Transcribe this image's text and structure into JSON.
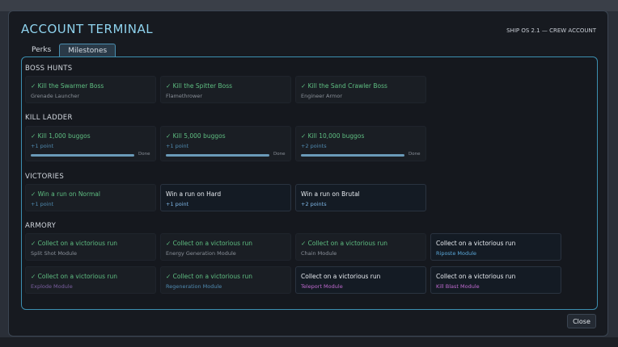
{
  "window": {
    "title": "ACCOUNT TERMINAL",
    "subtitle": "SHIP OS 2.1 — CREW ACCOUNT"
  },
  "tabs": [
    {
      "label": "Perks"
    },
    {
      "label": "Milestones"
    }
  ],
  "sections": {
    "boss_hunts": {
      "title": "BOSS HUNTS",
      "cards": [
        {
          "title": "✓ Kill the Swarmer Boss",
          "reward": "Grenade Launcher"
        },
        {
          "title": "✓ Kill the Spitter Boss",
          "reward": "Flamethrower"
        },
        {
          "title": "✓ Kill the Sand Crawler Boss",
          "reward": "Engineer Armor"
        }
      ]
    },
    "kill_ladder": {
      "title": "KILL LADDER",
      "cards": [
        {
          "title": "✓ Kill 1,000 buggos",
          "reward": "+1 point",
          "progress_label": "Done",
          "progress": 1.0
        },
        {
          "title": "✓ Kill 5,000 buggos",
          "reward": "+1 point",
          "progress_label": "Done",
          "progress": 1.0
        },
        {
          "title": "✓ Kill 10,000 buggos",
          "reward": "+2 points",
          "progress_label": "Done",
          "progress": 1.0
        }
      ]
    },
    "victories": {
      "title": "VICTORIES",
      "cards": [
        {
          "title": "✓ Win a run on Normal",
          "reward": "+1 point"
        },
        {
          "title": "Win a run on Hard",
          "reward": "+1 point"
        },
        {
          "title": "Win a run on Brutal",
          "reward": "+2 points"
        }
      ]
    },
    "armory": {
      "title": "ARMORY",
      "cards": [
        {
          "title": "✓ Collect on a victorious run",
          "reward": "Split Shot Module"
        },
        {
          "title": "✓ Collect on a victorious run",
          "reward": "Energy Generation Module"
        },
        {
          "title": "✓ Collect on a victorious run",
          "reward": "Chain Module"
        },
        {
          "title": "Collect on a victorious run",
          "reward": "Riposte Module"
        },
        {
          "title": "✓ Collect on a victorious run",
          "reward": "Explode Module"
        },
        {
          "title": "✓ Collect on a victorious run",
          "reward": "Regeneration Module"
        },
        {
          "title": "Collect on a victorious run",
          "reward": "Teleport Module"
        },
        {
          "title": "Collect on a victorious run",
          "reward": "Kill Blast Module"
        }
      ]
    }
  },
  "footer": {
    "close_label": "Close"
  },
  "colors": {
    "accent": "#8fd3ee",
    "done_green": "#5fbf82",
    "panel_border": "#3c8fb0"
  }
}
